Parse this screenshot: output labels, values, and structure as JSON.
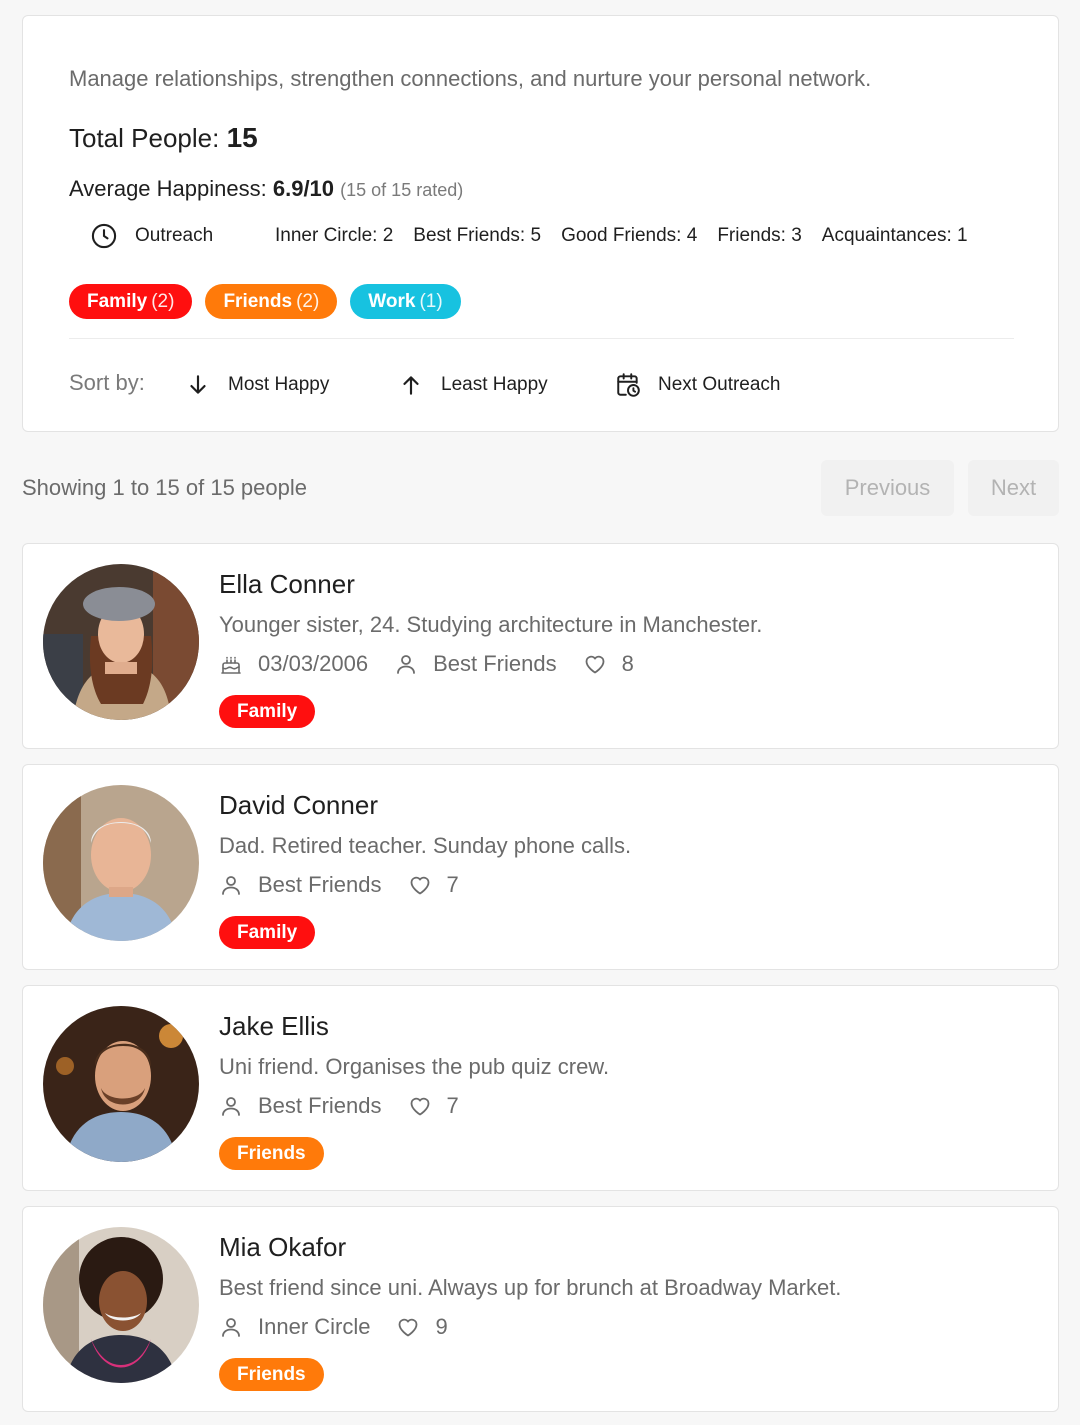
{
  "header": {
    "subtitle": "Manage relationships, strengthen connections, and nurture your personal network.",
    "total_label": "Total People:",
    "total_value": "15",
    "avg_label": "Average Happiness:",
    "avg_value": "6.9/10",
    "avg_rated": "(15 of 15 rated)",
    "outreach_label": "Outreach",
    "tiers": [
      {
        "label": "Inner Circle: 2"
      },
      {
        "label": "Best Friends: 5"
      },
      {
        "label": "Good Friends: 4"
      },
      {
        "label": "Friends: 3"
      },
      {
        "label": "Acquaintances: 1"
      }
    ],
    "tags": [
      {
        "name": "Family",
        "count": "(2)",
        "color": "#ff0f0f"
      },
      {
        "name": "Friends",
        "count": "(2)",
        "color": "#ff7a0a"
      },
      {
        "name": "Work",
        "count": "(1)",
        "color": "#17c2e0"
      }
    ],
    "sort": {
      "label": "Sort by:",
      "most_happy": "Most Happy",
      "least_happy": "Least Happy",
      "next_outreach": "Next Outreach"
    }
  },
  "pagination": {
    "showing": "Showing 1 to 15 of 15 people",
    "previous": "Previous",
    "next": "Next"
  },
  "people": [
    {
      "name": "Ella Conner",
      "description": "Younger sister, 24. Studying architecture in Manchester.",
      "birthday": "03/03/2006",
      "tier": "Best Friends",
      "happiness": "8",
      "tag": "Family",
      "tag_color": "#ff0f0f"
    },
    {
      "name": "David Conner",
      "description": "Dad. Retired teacher. Sunday phone calls.",
      "tier": "Best Friends",
      "happiness": "7",
      "tag": "Family",
      "tag_color": "#ff0f0f"
    },
    {
      "name": "Jake Ellis",
      "description": "Uni friend. Organises the pub quiz crew.",
      "tier": "Best Friends",
      "happiness": "7",
      "tag": "Friends",
      "tag_color": "#ff7a0a"
    },
    {
      "name": "Mia Okafor",
      "description": "Best friend since uni. Always up for brunch at Broadway Market.",
      "tier": "Inner Circle",
      "happiness": "9",
      "tag": "Friends",
      "tag_color": "#ff7a0a"
    }
  ]
}
